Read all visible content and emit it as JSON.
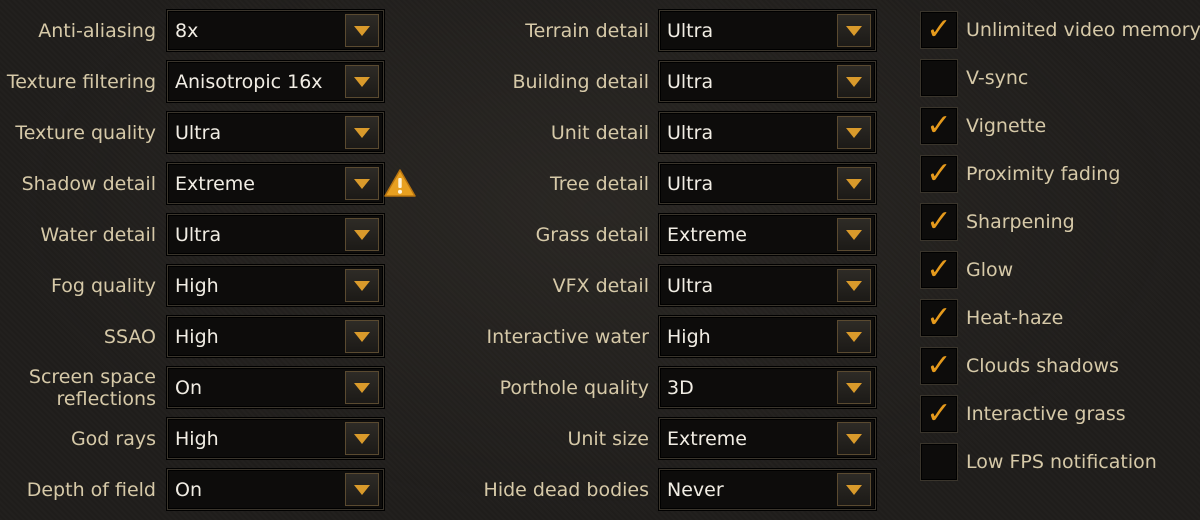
{
  "left_column": [
    {
      "label": "Anti-aliasing",
      "value": "8x"
    },
    {
      "label": "Texture filtering",
      "value": "Anisotropic 16x"
    },
    {
      "label": "Texture quality",
      "value": "Ultra"
    },
    {
      "label": "Shadow detail",
      "value": "Extreme",
      "warning": true
    },
    {
      "label": "Water detail",
      "value": "Ultra"
    },
    {
      "label": "Fog quality",
      "value": "High"
    },
    {
      "label": "SSAO",
      "value": "High"
    },
    {
      "label": "Screen space reflections",
      "value": "On"
    },
    {
      "label": "God rays",
      "value": "High"
    },
    {
      "label": "Depth of field",
      "value": "On"
    }
  ],
  "middle_column": [
    {
      "label": "Terrain detail",
      "value": "Ultra"
    },
    {
      "label": "Building detail",
      "value": "Ultra"
    },
    {
      "label": "Unit detail",
      "value": "Ultra"
    },
    {
      "label": "Tree detail",
      "value": "Ultra"
    },
    {
      "label": "Grass detail",
      "value": "Extreme"
    },
    {
      "label": "VFX detail",
      "value": "Ultra"
    },
    {
      "label": "Interactive water",
      "value": "High"
    },
    {
      "label": "Porthole quality",
      "value": "3D"
    },
    {
      "label": "Unit size",
      "value": "Extreme"
    },
    {
      "label": "Hide dead bodies",
      "value": "Never"
    }
  ],
  "checkboxes": [
    {
      "label": "Unlimited video memory",
      "checked": true
    },
    {
      "label": "V-sync",
      "checked": false
    },
    {
      "label": "Vignette",
      "checked": true
    },
    {
      "label": "Proximity fading",
      "checked": true
    },
    {
      "label": "Sharpening",
      "checked": true
    },
    {
      "label": "Glow",
      "checked": true
    },
    {
      "label": "Heat-haze",
      "checked": true
    },
    {
      "label": "Clouds shadows",
      "checked": true
    },
    {
      "label": "Interactive grass",
      "checked": true
    },
    {
      "label": "Low FPS notification",
      "checked": false
    }
  ],
  "icons": {
    "dropdown_arrow": "chevron-down-icon",
    "warning": "warning-icon",
    "check": "checkmark-icon"
  },
  "colors": {
    "accent": "#e59a1c",
    "label_text": "#d6c9a8",
    "value_text": "#f1ede4",
    "warning": "#e8a020"
  }
}
